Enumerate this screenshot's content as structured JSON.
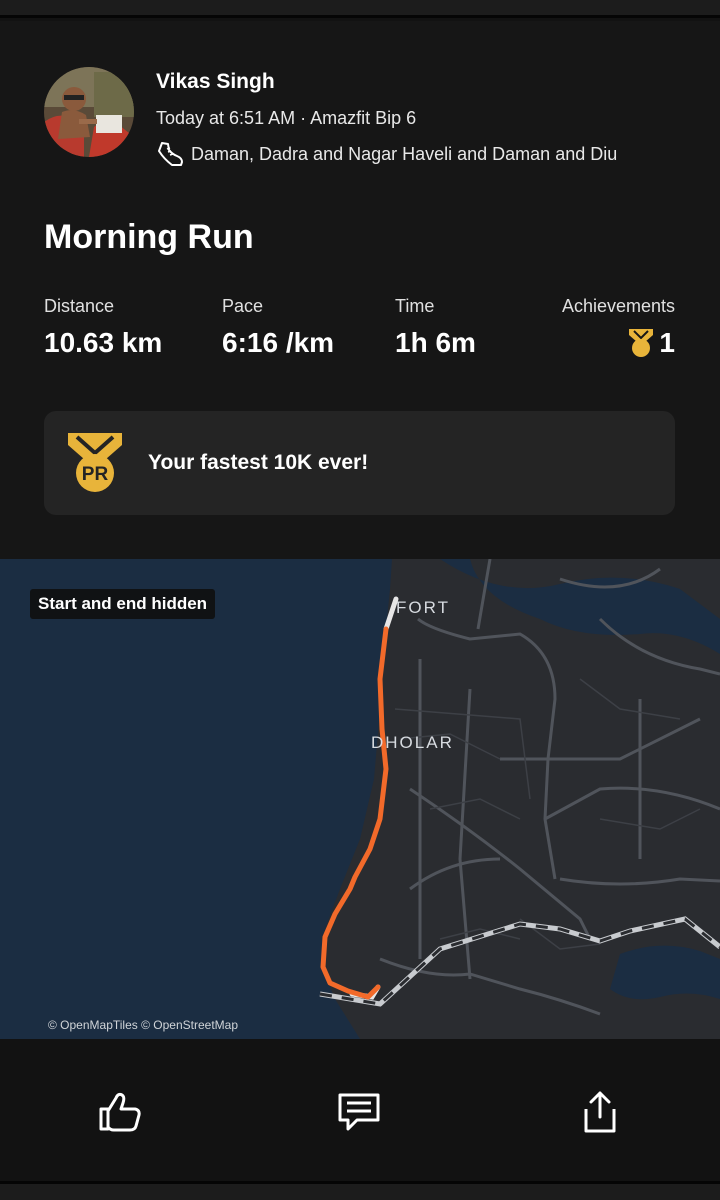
{
  "athlete": {
    "name": "Vikas Singh",
    "meta": "Today at 6:51 AM · Amazfit Bip 6",
    "location": "Daman, Dadra and Nagar Haveli and Daman and Diu"
  },
  "activity": {
    "title": "Morning Run",
    "stats": {
      "distance": {
        "label": "Distance",
        "value": "10.63 km"
      },
      "pace": {
        "label": "Pace",
        "value": "6:16 /km"
      },
      "time": {
        "label": "Time",
        "value": "1h 6m"
      },
      "achievements": {
        "label": "Achievements",
        "value": "1"
      }
    },
    "pr": {
      "icon_text": "PR",
      "text": "Your fastest 10K ever!"
    }
  },
  "map": {
    "badge": "Start and end hidden",
    "labels": {
      "fort": "FORT",
      "dholar": "DHOLAR"
    },
    "attribution": "© OpenMapTiles © OpenStreetMap",
    "colors": {
      "water": "#1b2d42",
      "land": "#2a2c30",
      "route": "#f26a2a",
      "roads": "#50545b"
    }
  },
  "actions": {
    "like": "thumbs-up-icon",
    "comment": "comment-icon",
    "share": "share-icon"
  },
  "colors": {
    "accent": "#f26a2a",
    "medal": "#e8b43a",
    "background": "#161616"
  }
}
